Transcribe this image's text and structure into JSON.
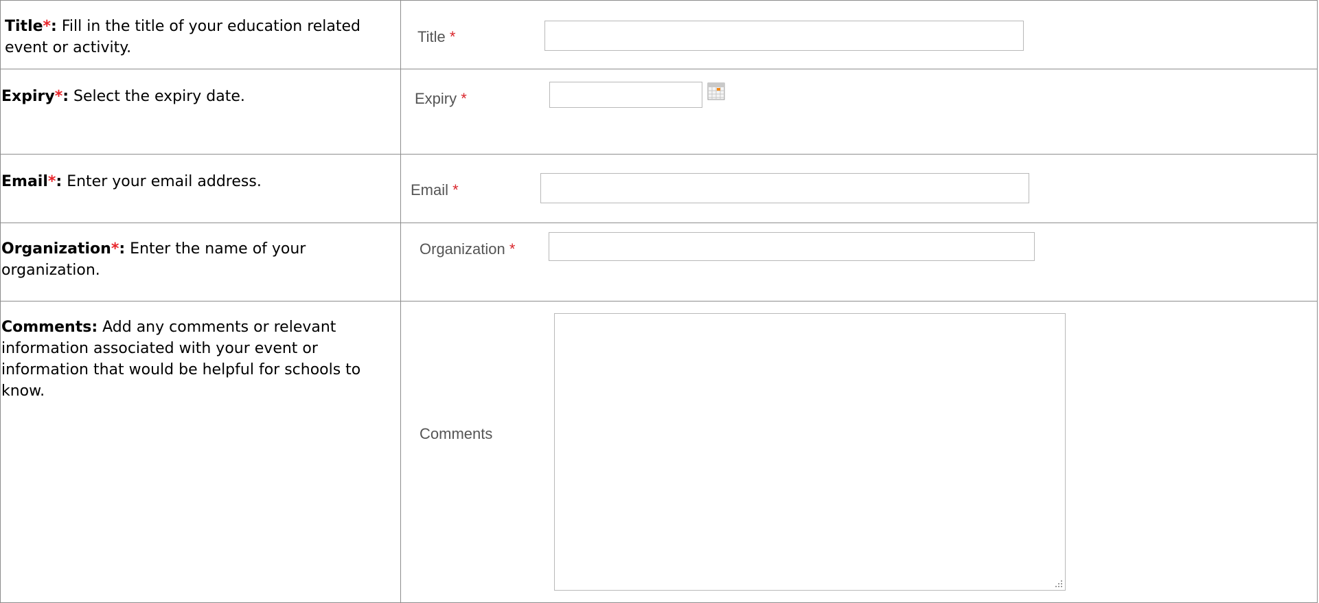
{
  "rows": [
    {
      "term": "Title",
      "required_mark": "*",
      "colon": ":",
      "description": " Fill in the title of your education related event or activity.",
      "field_label": "Title",
      "field_required_mark": "*",
      "field_value": "",
      "field_icon": "none"
    },
    {
      "term": "Expiry",
      "required_mark": "*",
      "colon": ":",
      "description": " Select the expiry date.",
      "field_label": "Expiry",
      "field_required_mark": "*",
      "field_value": "",
      "field_icon": "calendar-icon"
    },
    {
      "term": "Email",
      "required_mark": "*",
      "colon": ":",
      "description": " Enter your email address.",
      "field_label": "Email",
      "field_required_mark": "*",
      "field_value": "",
      "field_icon": "none"
    },
    {
      "term": "Organization",
      "required_mark": "*",
      "colon": ":",
      "description": " Enter the name of your organization.",
      "field_label": "Organization",
      "field_required_mark": "*",
      "field_value": "",
      "field_icon": "none"
    },
    {
      "term": "Comments",
      "required_mark": "",
      "colon": ":",
      "description": " Add any comments or relevant information associated with your event or information that would be helpful for schools to know.",
      "field_label": "Comments",
      "field_required_mark": "",
      "field_value": "",
      "field_icon": "resize-grip-icon"
    }
  ],
  "colors": {
    "required_star": "#e8252b",
    "field_label_text": "#555555",
    "table_border": "#8c8c8c",
    "input_border": "#b8b8b8"
  }
}
